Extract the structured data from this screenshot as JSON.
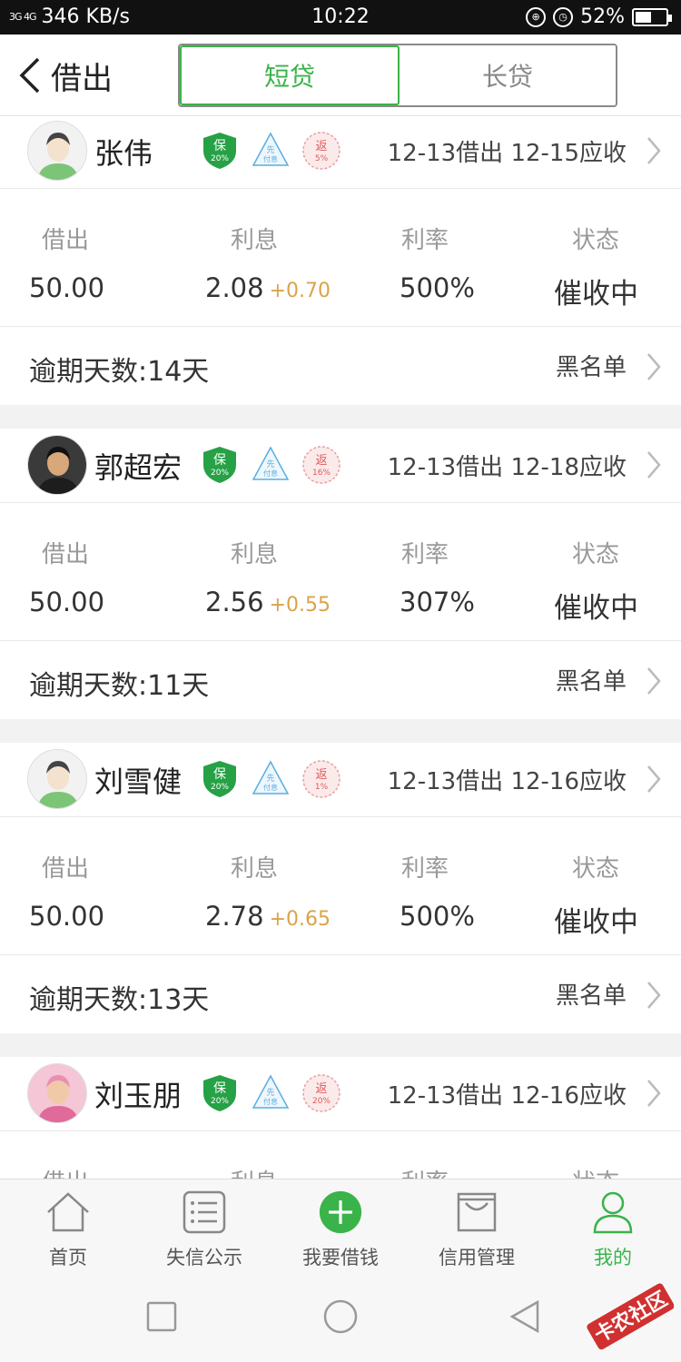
{
  "status_bar": {
    "signal": "3G  4G",
    "speed": "346 KB/s",
    "time": "10:22",
    "battery_text": "52%",
    "battery_level": 0.52
  },
  "header": {
    "back_label": "借出",
    "tabs": [
      {
        "label": "短贷",
        "active": true
      },
      {
        "label": "长贷",
        "active": false
      }
    ]
  },
  "labels": {
    "lent": "借出",
    "interest": "利息",
    "rate": "利率",
    "status": "状态",
    "blacklist": "黑名单"
  },
  "badges": {
    "bao": "保",
    "xian_top": "先",
    "xian_bottom": "付息",
    "fan": "返"
  },
  "loans": [
    {
      "name": "张伟",
      "bao_pct": "20%",
      "fan_pct": "5%",
      "dates": "12-13借出 12-15应收",
      "amount": "50.00",
      "interest": "2.08",
      "interest_extra": "+0.70",
      "rate": "500%",
      "status": "催收中",
      "overdue": "逾期天数:14天",
      "avatar": "default"
    },
    {
      "name": "郭超宏",
      "bao_pct": "20%",
      "fan_pct": "16%",
      "dates": "12-13借出 12-18应收",
      "amount": "50.00",
      "interest": "2.56",
      "interest_extra": "+0.55",
      "rate": "307%",
      "status": "催收中",
      "overdue": "逾期天数:11天",
      "avatar": "photo"
    },
    {
      "name": "刘雪健",
      "bao_pct": "20%",
      "fan_pct": "1%",
      "dates": "12-13借出 12-16应收",
      "amount": "50.00",
      "interest": "2.78",
      "interest_extra": "+0.65",
      "rate": "500%",
      "status": "催收中",
      "overdue": "逾期天数:13天",
      "avatar": "default"
    },
    {
      "name": "刘玉朋",
      "bao_pct": "20%",
      "fan_pct": "20%",
      "dates": "12-13借出 12-16应收",
      "amount": "",
      "interest": "",
      "interest_extra": "",
      "rate": "",
      "status": "",
      "overdue": "",
      "avatar": "photo-pink"
    }
  ],
  "tabbar": [
    {
      "label": "首页",
      "icon": "home-icon",
      "active": false
    },
    {
      "label": "失信公示",
      "icon": "list-icon",
      "active": false
    },
    {
      "label": "我要借钱",
      "icon": "plus-circle-icon",
      "active": false
    },
    {
      "label": "信用管理",
      "icon": "box-icon",
      "active": false
    },
    {
      "label": "我的",
      "icon": "person-icon",
      "active": true
    }
  ],
  "watermark": "卡农社区",
  "colors": {
    "accent": "#3ab34a",
    "interest_extra": "#d9a44a",
    "fan_badge": "#e05a5a",
    "xian_badge": "#5aaee0"
  }
}
